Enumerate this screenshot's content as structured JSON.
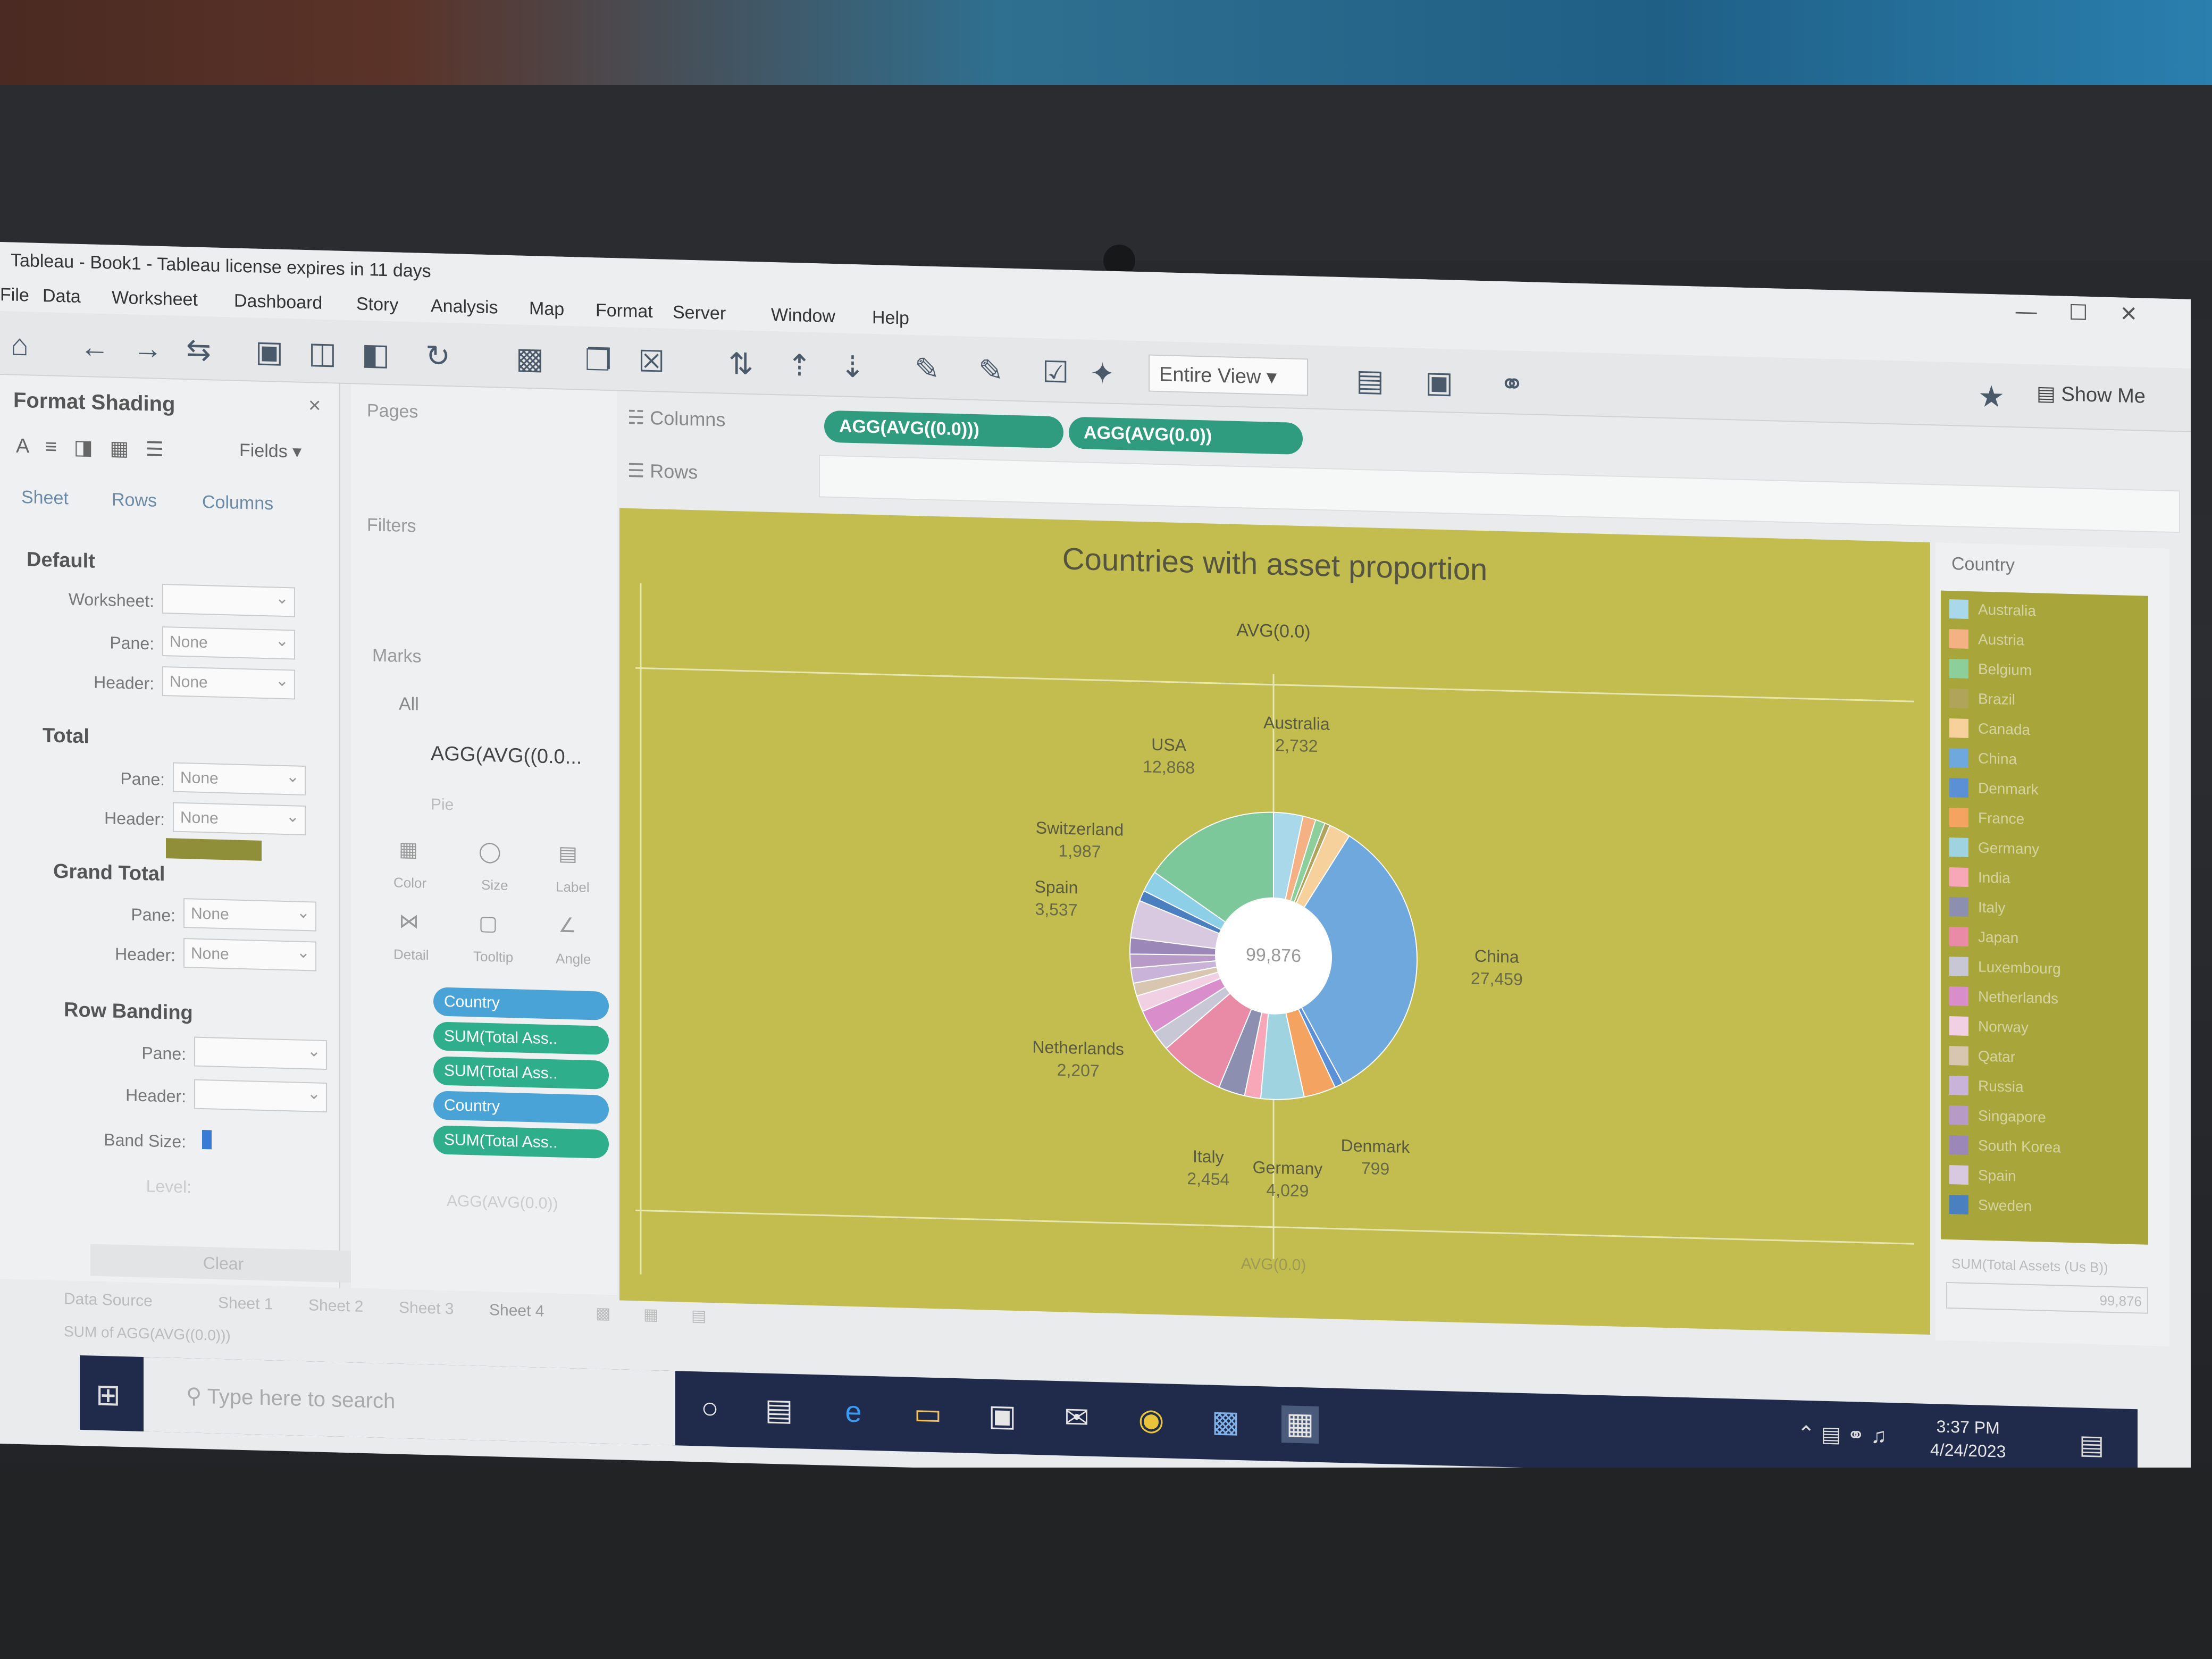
{
  "window": {
    "title": "Tableau - Book1 - Tableau license expires in 11 days"
  },
  "menu": [
    "File",
    "Data",
    "Worksheet",
    "Dashboard",
    "Story",
    "Analysis",
    "Map",
    "Format",
    "Server",
    "Window",
    "Help"
  ],
  "toolbar": {
    "view_mode": "Entire View",
    "show_me": "Show Me"
  },
  "format_panel": {
    "title": "Format Shading",
    "fields_label": "Fields",
    "tabs": [
      "Sheet",
      "Rows",
      "Columns"
    ],
    "default_heading": "Default",
    "worksheet_label": "Worksheet:",
    "pane_label": "Pane:",
    "header_label": "Header:",
    "none": "None",
    "total_heading": "Total",
    "grand_total_heading": "Grand Total",
    "row_banding_heading": "Row Banding",
    "band_size_label": "Band Size:",
    "level_label": "Level:",
    "clear_label": "Clear",
    "worksheet_color": "#8f8f3a"
  },
  "side_panels": {
    "pages": "Pages",
    "filters": "Filters",
    "marks": "Marks",
    "all": "All",
    "measure1": "AGG(AVG((0.0...",
    "mark_type": "Pie",
    "mark_buttons": [
      "Color",
      "Size",
      "Label",
      "Detail",
      "Tooltip",
      "Angle"
    ],
    "pills": [
      "Country",
      "SUM(Total Ass..",
      "SUM(Total Ass..",
      "Country",
      "SUM(Total Ass.."
    ],
    "measure2": "AGG(AVG(0.0))"
  },
  "shelves": {
    "columns_label": "Columns",
    "rows_label": "Rows",
    "column_pills": [
      "AGG(AVG((0.0)))",
      "AGG(AVG(0.0))"
    ]
  },
  "viz": {
    "title": "Countries with asset proportion",
    "top_axis_label": "AVG(0.0)",
    "bottom_axis_label": "AVG(0.0)",
    "background_color": "#c2bd4e",
    "center_total": "99,876"
  },
  "chart_data": {
    "type": "pie",
    "title": "Countries with asset proportion",
    "center_label": "99,876",
    "series": [
      {
        "name": "Australia",
        "value": 2732,
        "color": "#a8d8ea"
      },
      {
        "name": "Austria",
        "value": 1200,
        "color": "#f4b183"
      },
      {
        "name": "Belgium",
        "value": 900,
        "color": "#8ccf9a"
      },
      {
        "name": "Brazil",
        "value": 500,
        "color": "#b0a35a"
      },
      {
        "name": "Canada",
        "value": 2000,
        "color": "#f6d19b"
      },
      {
        "name": "China",
        "value": 27459,
        "color": "#6fa8dc"
      },
      {
        "name": "Denmark",
        "value": 799,
        "color": "#5b8fd6"
      },
      {
        "name": "France",
        "value": 3000,
        "color": "#f4a460"
      },
      {
        "name": "Germany",
        "value": 4029,
        "color": "#9fd3e0"
      },
      {
        "name": "India",
        "value": 1500,
        "color": "#f7a7b8"
      },
      {
        "name": "Italy",
        "value": 2454,
        "color": "#8c8fb0"
      },
      {
        "name": "Japan",
        "value": 6000,
        "color": "#e98aa6"
      },
      {
        "name": "Luxembourg",
        "value": 1800,
        "color": "#c7c7d6"
      },
      {
        "name": "Netherlands",
        "value": 2207,
        "color": "#d98ecb"
      },
      {
        "name": "Norway",
        "value": 1500,
        "color": "#f2d0e4"
      },
      {
        "name": "Qatar",
        "value": 1200,
        "color": "#d9c6b0"
      },
      {
        "name": "Russia",
        "value": 1400,
        "color": "#c9b3d9"
      },
      {
        "name": "Singapore",
        "value": 1300,
        "color": "#b89ac7"
      },
      {
        "name": "South Korea",
        "value": 1500,
        "color": "#9b87b8"
      },
      {
        "name": "Spain",
        "value": 3537,
        "color": "#d9c9e0"
      },
      {
        "name": "Sweden",
        "value": 1000,
        "color": "#4a7fc0"
      },
      {
        "name": "Switzerland",
        "value": 1987,
        "color": "#8ecfe8"
      },
      {
        "name": "USA",
        "value": 12868,
        "color": "#7cc89a"
      }
    ],
    "labels_shown": [
      {
        "name": "Australia",
        "value": "2,732"
      },
      {
        "name": "China",
        "value": "27,459"
      },
      {
        "name": "Denmark",
        "value": "799"
      },
      {
        "name": "Germany",
        "value": "4,029"
      },
      {
        "name": "Italy",
        "value": "2,454"
      },
      {
        "name": "Netherlands",
        "value": "2,207"
      },
      {
        "name": "Spain",
        "value": "3,537"
      },
      {
        "name": "Switzerland",
        "value": "1,987"
      },
      {
        "name": "USA",
        "value": "12,868"
      }
    ]
  },
  "legend": {
    "title": "Country",
    "items": [
      "Australia",
      "Austria",
      "Belgium",
      "Brazil",
      "Canada",
      "China",
      "Denmark",
      "France",
      "Germany",
      "India",
      "Italy",
      "Japan",
      "Luxembourg",
      "Netherlands",
      "Norway",
      "Qatar",
      "Russia",
      "Singapore",
      "South Korea",
      "Spain",
      "Sweden"
    ],
    "size_title": "SUM(Total Assets (Us B))",
    "size_value": "99,876"
  },
  "sheets": {
    "data_source": "Data Source",
    "tabs": [
      "Sheet 1",
      "Sheet 2",
      "Sheet 3",
      "Sheet 4"
    ],
    "status": "SUM of AGG(AVG((0.0)))"
  },
  "taskbar": {
    "search_placeholder": "Type here to search",
    "time": "3:37 PM",
    "date": "4/24/2023"
  }
}
